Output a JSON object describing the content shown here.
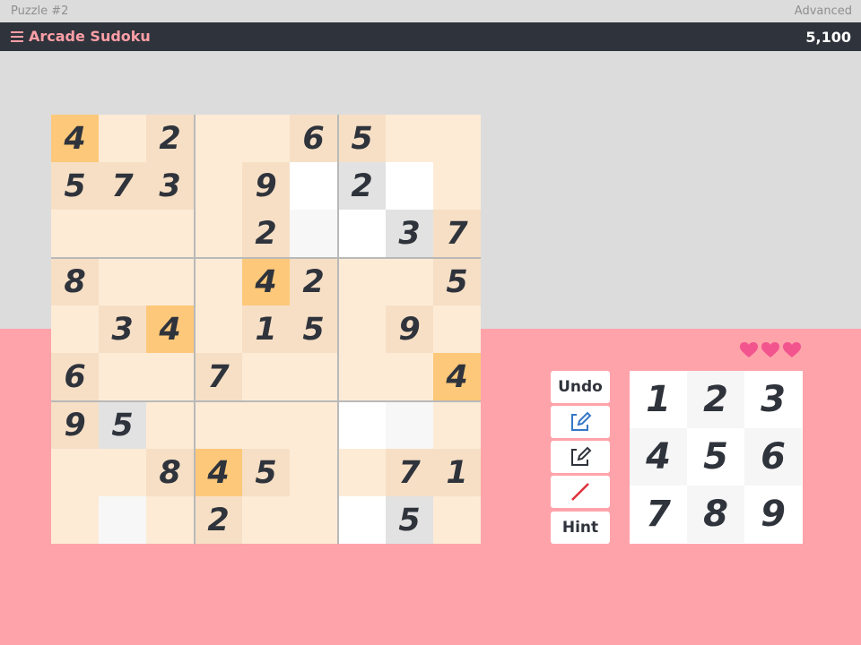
{
  "top": {
    "puzzle_label": "Puzzle #2",
    "difficulty": "Advanced"
  },
  "header": {
    "title": "Arcade Sudoku",
    "score": "5,100",
    "menu_icon": "hamburger-icon"
  },
  "colors": {
    "header_bg": "#2f333b",
    "accent_pink": "#ff9fa7",
    "bottom_bg": "#ffa3aa",
    "highlight": "#fdc87a",
    "same_number": "#f6dfc5",
    "base": "#fdebd6",
    "white": "#ffffff",
    "grey": "#e2e2e2",
    "heart": "#f2548e"
  },
  "board": {
    "rows": [
      [
        "4",
        "",
        "2",
        "",
        "",
        "6",
        "5",
        "",
        ""
      ],
      [
        "5",
        "7",
        "3",
        "",
        "9",
        "",
        "2",
        "",
        ""
      ],
      [
        "",
        "",
        "",
        "",
        "2",
        "",
        "",
        "3",
        "7"
      ],
      [
        "8",
        "",
        "",
        "",
        "4",
        "2",
        "",
        "",
        "5"
      ],
      [
        "",
        "3",
        "4",
        "",
        "1",
        "5",
        "",
        "9",
        ""
      ],
      [
        "6",
        "",
        "",
        "7",
        "",
        "",
        "",
        "",
        "4"
      ],
      [
        "9",
        "5",
        "",
        "",
        "",
        "",
        "",
        "",
        ""
      ],
      [
        "",
        "",
        "8",
        "4",
        "5",
        "",
        "",
        "7",
        "1"
      ],
      [
        "",
        "",
        "",
        "2",
        "",
        "",
        "",
        "5",
        ""
      ]
    ],
    "shades": [
      [
        "h",
        "b",
        "d",
        "b",
        "b",
        "d",
        "d",
        "b",
        "b"
      ],
      [
        "d",
        "d",
        "d",
        "b",
        "d",
        "w",
        "g",
        "w",
        "b"
      ],
      [
        "b",
        "b",
        "b",
        "b",
        "d",
        "l",
        "w",
        "g",
        "d"
      ],
      [
        "d",
        "b",
        "b",
        "b",
        "h",
        "d",
        "b",
        "b",
        "d"
      ],
      [
        "b",
        "d",
        "h",
        "b",
        "d",
        "d",
        "b",
        "d",
        "b"
      ],
      [
        "d",
        "b",
        "b",
        "d",
        "b",
        "b",
        "b",
        "b",
        "h"
      ],
      [
        "d",
        "g",
        "b",
        "b",
        "b",
        "b",
        "w",
        "l",
        "b"
      ],
      [
        "b",
        "b",
        "d",
        "h",
        "d",
        "b",
        "b",
        "d",
        "d"
      ],
      [
        "b",
        "l",
        "b",
        "d",
        "b",
        "b",
        "w",
        "g",
        "b"
      ]
    ]
  },
  "controls": {
    "undo_label": "Undo",
    "pen_icon": "pen-icon",
    "note_icon": "pencil-note-icon",
    "erase_icon": "eraser-slash-icon",
    "hint_label": "Hint"
  },
  "numpad": [
    "1",
    "2",
    "3",
    "4",
    "5",
    "6",
    "7",
    "8",
    "9"
  ],
  "lives": {
    "count": 3,
    "icon": "heart-icon"
  }
}
